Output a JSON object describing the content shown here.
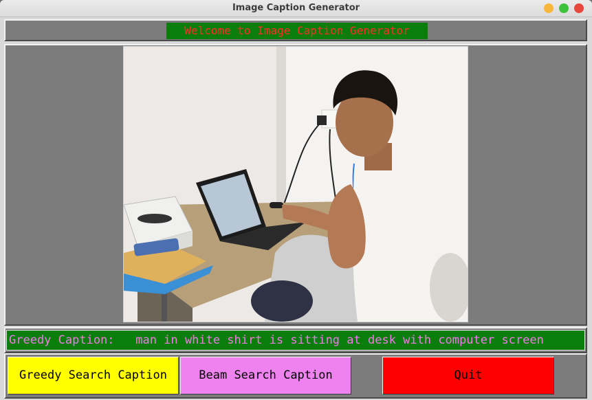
{
  "window": {
    "title": "Image Caption Generator"
  },
  "header": {
    "welcome_text": "Welcome to Image Caption Generator"
  },
  "image": {
    "description_icon": "photo"
  },
  "caption": {
    "text": "Greedy Caption:   man in white shirt is sitting at desk with computer screen"
  },
  "buttons": {
    "greedy": "Greedy Search Caption",
    "beam": "Beam Search Caption",
    "quit": "Quit"
  },
  "colors": {
    "header_bg": "#0b7d0b",
    "header_text": "#ff2b2b",
    "caption_text": "#ee7be8",
    "greedy_bg": "#ffff00",
    "beam_bg": "#ee82ee",
    "quit_bg": "#ff0000"
  }
}
